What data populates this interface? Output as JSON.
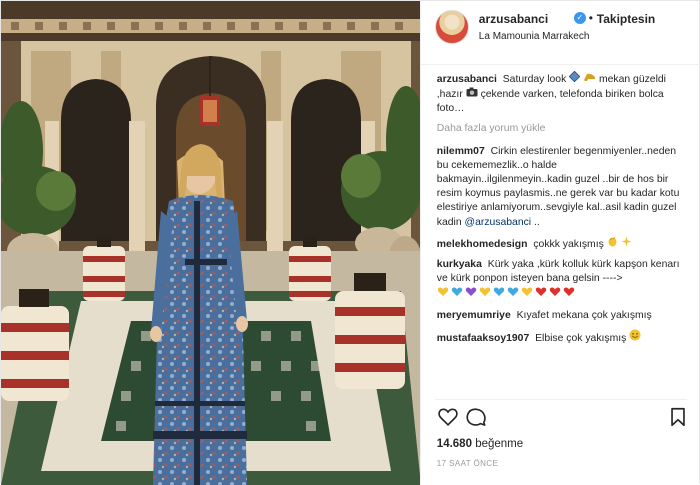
{
  "header": {
    "username": "arzusabanci",
    "separator": "•",
    "follow_status": "Takiptesin",
    "location": "La Mamounia Marrakech"
  },
  "caption": {
    "username": "arzusabanci",
    "text_1": "Saturday look",
    "text_2": "mekan güzeldi ,hazır",
    "text_3": "çekende varken, telefonda biriken bolca foto…"
  },
  "load_more": "Daha fazla yorum yükle",
  "comments": [
    {
      "username": "nilemm07",
      "text": "Cirkin elestirenler begenmiyenler..neden bu cekememezlik..o halde bakmayin..ilgilenmeyin..kadin guzel ..bir de hos bir resim koymus paylasmis..ne gerek var bu kadar kotu elestiriye anlamiyorum..sevgiyle kal..asil kadin guzel kadin",
      "mention": "@arzusabanci",
      "tail": ".."
    },
    {
      "username": "melekhomedesign",
      "text": "çokkk yakışmış"
    },
    {
      "username": "kurkyaka",
      "text": "Kürk yaka ,kürk kolluk kürk kapşon kenarı ve kürk ponpon isteyen bana gelsin ---->"
    },
    {
      "username": "meryemumriye",
      "text": "Kıyafet mekana çok yakışmış"
    },
    {
      "username": "mustafaaksoy1907",
      "text": "Elbise çok yakışmış"
    }
  ],
  "likes": {
    "count": "14.680",
    "label": "beğenme"
  },
  "timestamp": "17 SAAT ÖNCE",
  "icons": {
    "like": "heart-icon",
    "comment": "comment-bubble-icon",
    "save": "bookmark-icon",
    "verified": "verified-badge-icon"
  },
  "colors": {
    "accent": "#3897f0",
    "text": "#262626",
    "muted": "#999999",
    "mention": "#003569"
  }
}
